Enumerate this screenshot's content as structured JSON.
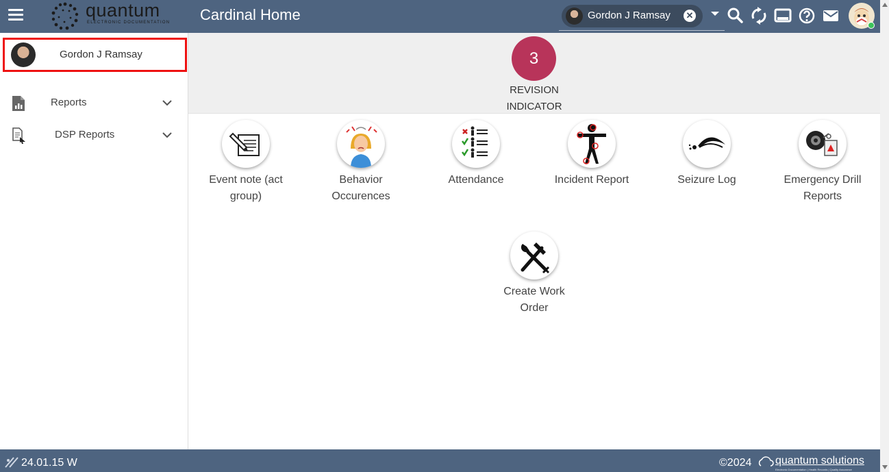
{
  "header": {
    "logo_word": "quantum",
    "logo_sub": "ELECTRONIC DOCUMENTATION",
    "title": "Cardinal Home",
    "user_chip_name": "Gordon J Ramsay",
    "icons": [
      "menu-icon",
      "caret-down-icon",
      "search-icon",
      "sync-icon",
      "display-icon",
      "help-icon",
      "mail-icon",
      "user-avatar"
    ]
  },
  "sidebar": {
    "profile_name": "Gordon J Ramsay",
    "items": [
      {
        "label": "Reports",
        "icon": "report-chart-icon"
      },
      {
        "label": "DSP Reports",
        "icon": "document-pointer-icon"
      }
    ]
  },
  "revision": {
    "count": "3",
    "label_line1": "REVISION",
    "label_line2": "INDICATOR",
    "color": "#b8345a"
  },
  "tiles": [
    {
      "line1": "Event note (act",
      "line2": "group)",
      "icon": "note-pencil-icon"
    },
    {
      "line1": "Behavior",
      "line2": "Occurences",
      "icon": "frustrated-woman-icon"
    },
    {
      "line1": "Attendance",
      "line2": "",
      "icon": "attendance-checklist-icon"
    },
    {
      "line1": "Incident Report",
      "line2": "",
      "icon": "injured-person-icon"
    },
    {
      "line1": "Seizure Log",
      "line2": "",
      "icon": "seizure-icon"
    },
    {
      "line1": "Emergency Drill",
      "line2": "Reports",
      "icon": "alarm-bell-icon"
    },
    {
      "line1": "Create Work",
      "line2": "Order",
      "icon": "hammer-wrench-icon"
    }
  ],
  "footer": {
    "version": "24.01.15 W",
    "copyright": "©2024",
    "brand": "quantum solutions",
    "brand_sub": "Electronic Documentation | Health Records | Quality Assurance"
  },
  "colors": {
    "bar": "#4e6480",
    "chip": "#3c4b5e",
    "highlight_border": "#ee1111"
  }
}
